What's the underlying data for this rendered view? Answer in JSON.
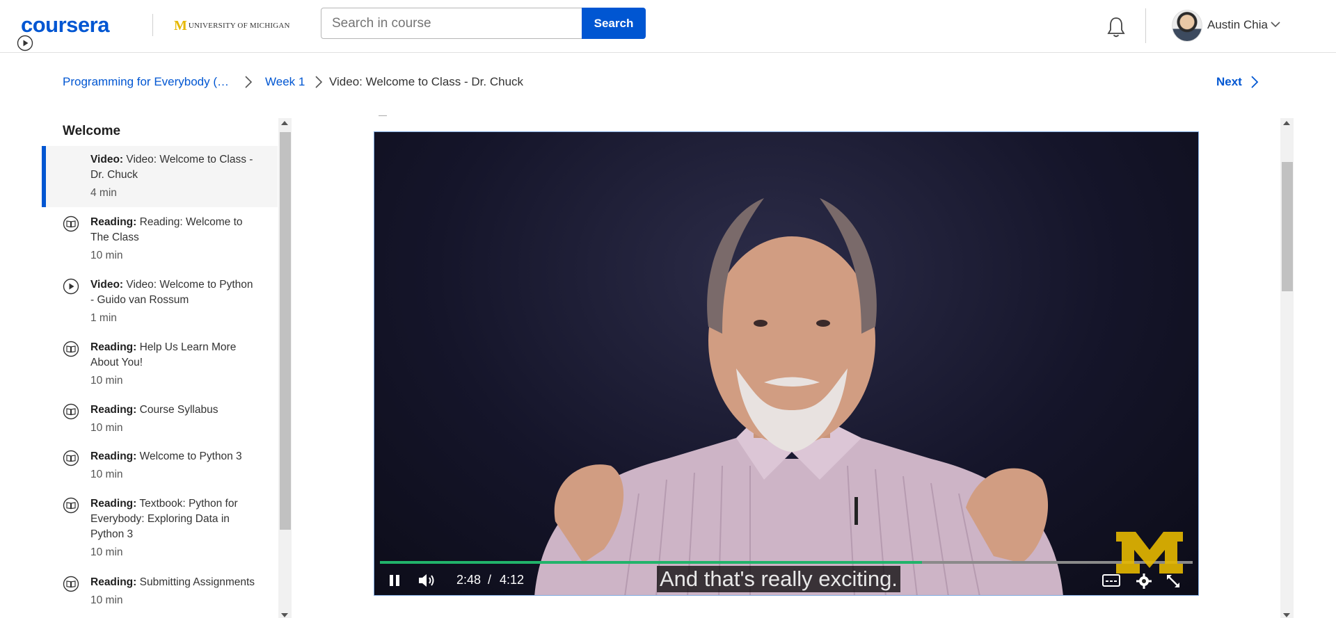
{
  "header": {
    "logo": "coursera",
    "partner": "UNIVERSITY OF MICHIGAN",
    "partner_mark": "M",
    "search_placeholder": "Search in course",
    "search_button": "Search",
    "user_name": "Austin Chia"
  },
  "breadcrumb": {
    "course": "Programming for Everybody (…",
    "week": "Week 1",
    "current": "Video: Welcome to Class - Dr. Chuck",
    "next": "Next"
  },
  "sidebar": {
    "module_title": "Welcome",
    "items": [
      {
        "type": "Video:",
        "title": "Video: Welcome to Class - Dr. Chuck",
        "duration": "4 min",
        "icon": "play-icon",
        "active": true
      },
      {
        "type": "Reading:",
        "title": "Reading: Welcome to The Class",
        "duration": "10 min",
        "icon": "book-icon"
      },
      {
        "type": "Video:",
        "title": "Video: Welcome to Python - Guido van Rossum",
        "duration": "1 min",
        "icon": "play-icon"
      },
      {
        "type": "Reading:",
        "title": "Help Us Learn More About You!",
        "duration": "10 min",
        "icon": "book-icon"
      },
      {
        "type": "Reading:",
        "title": "Course Syllabus",
        "duration": "10 min",
        "icon": "book-icon"
      },
      {
        "type": "Reading:",
        "title": "Welcome to Python 3",
        "duration": "10 min",
        "icon": "book-icon"
      },
      {
        "type": "Reading:",
        "title": "Textbook: Python for Everybody: Exploring Data in Python 3",
        "duration": "10 min",
        "icon": "book-icon"
      },
      {
        "type": "Reading:",
        "title": "Submitting Assignments",
        "duration": "10 min",
        "icon": "book-icon"
      }
    ]
  },
  "video": {
    "current_time": "2:48",
    "separator": "/",
    "total_time": "4:12",
    "progress_fraction": 0.667,
    "caption": "And that's really exciting.",
    "watermark": "M"
  },
  "colors": {
    "brand": "#0056d2",
    "progress": "#21b36a",
    "michigan_maize": "#e6b800"
  }
}
